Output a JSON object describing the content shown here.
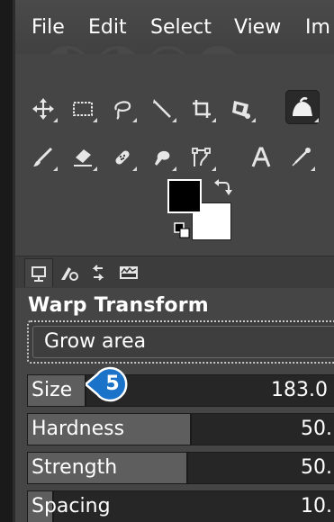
{
  "menu": {
    "items": [
      "File",
      "Edit",
      "Select",
      "View",
      "Im"
    ]
  },
  "toolbox": {
    "row1": [
      "move-tool-icon",
      "rect-select-tool-icon",
      "free-select-tool-icon",
      "fuzzy-select-tool-icon",
      "crop-tool-icon",
      "unified-transform-tool-icon",
      "warp-transform-tool-icon"
    ],
    "row2": [
      "paintbrush-tool-icon",
      "eraser-tool-icon",
      "heal-tool-icon",
      "smudge-tool-icon",
      "paths-tool-icon",
      "text-tool-icon",
      "color-picker-tool-icon"
    ],
    "active_tool": "warp-transform-tool-icon"
  },
  "colors": {
    "foreground": "#000000",
    "background": "#ffffff",
    "accent": "#1a73c8"
  },
  "dock_tabs": [
    "tool-options-tab-icon",
    "device-status-tab-icon",
    "undo-history-tab-icon",
    "images-tab-icon"
  ],
  "tool_options": {
    "title": "Warp Transform",
    "mode": "Grow area",
    "sliders": [
      {
        "label": "Size",
        "value": "183.0",
        "fill": 0.18
      },
      {
        "label": "Hardness",
        "value": "50.",
        "fill": 0.5
      },
      {
        "label": "Strength",
        "value": "50.",
        "fill": 0.49
      },
      {
        "label": "Spacing",
        "value": "10.",
        "fill": 0.08
      }
    ]
  },
  "callout": {
    "step": "5"
  }
}
